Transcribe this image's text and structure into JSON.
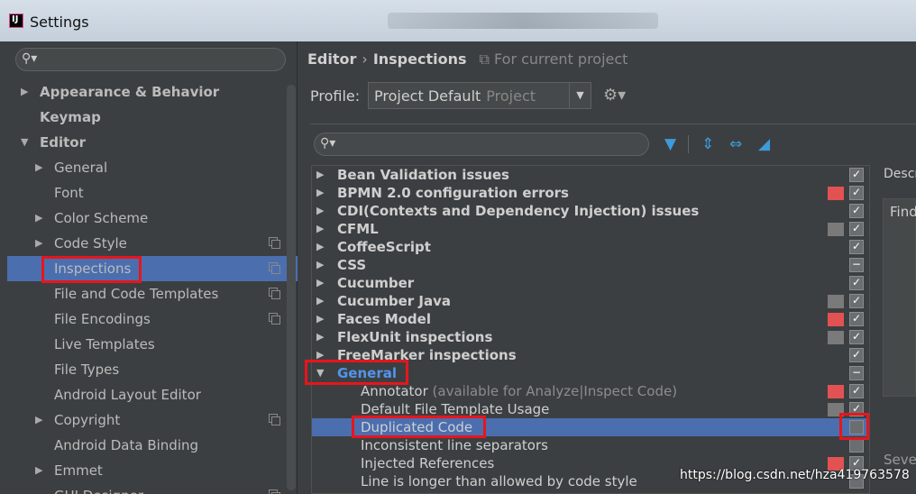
{
  "window": {
    "title": "Settings",
    "app_icon": "IJ"
  },
  "left": {
    "search_placeholder": "",
    "items": [
      {
        "label": "Appearance & Behavior",
        "level": 0,
        "arrow": "▶",
        "bold": true
      },
      {
        "label": "Keymap",
        "level": 0,
        "arrow": "",
        "bold": true
      },
      {
        "label": "Editor",
        "level": 0,
        "arrow": "▼",
        "bold": true
      },
      {
        "label": "General",
        "level": 1,
        "arrow": "▶"
      },
      {
        "label": "Font",
        "level": 1,
        "arrow": ""
      },
      {
        "label": "Color Scheme",
        "level": 1,
        "arrow": "▶"
      },
      {
        "label": "Code Style",
        "level": 1,
        "arrow": "▶",
        "proj": true
      },
      {
        "label": "Inspections",
        "level": 1,
        "arrow": "",
        "proj": true,
        "selected": true
      },
      {
        "label": "File and Code Templates",
        "level": 1,
        "arrow": "",
        "proj": true
      },
      {
        "label": "File Encodings",
        "level": 1,
        "arrow": "",
        "proj": true
      },
      {
        "label": "Live Templates",
        "level": 1,
        "arrow": ""
      },
      {
        "label": "File Types",
        "level": 1,
        "arrow": ""
      },
      {
        "label": "Android Layout Editor",
        "level": 1,
        "arrow": ""
      },
      {
        "label": "Copyright",
        "level": 1,
        "arrow": "▶",
        "proj": true
      },
      {
        "label": "Android Data Binding",
        "level": 1,
        "arrow": ""
      },
      {
        "label": "Emmet",
        "level": 1,
        "arrow": "▶"
      },
      {
        "label": "GUI Designer",
        "level": 1,
        "arrow": "",
        "proj": true
      }
    ]
  },
  "right": {
    "breadcrumb": {
      "parent": "Editor",
      "current": "Inspections",
      "scope": "For current project"
    },
    "profile": {
      "label": "Profile:",
      "value": "Project Default",
      "scope": "Project"
    },
    "search_placeholder": "",
    "description_label": "Descr",
    "description_text": "Find",
    "severity_label": "Seve",
    "inspections": [
      {
        "label": "Bean Validation issues",
        "type": "group",
        "severity": "",
        "check": "✓"
      },
      {
        "label": "BPMN 2.0 configuration errors",
        "type": "group",
        "severity": "#e35252",
        "check": "✓"
      },
      {
        "label": "CDI(Contexts and Dependency Injection) issues",
        "type": "group",
        "severity": "",
        "check": "✓"
      },
      {
        "label": "CFML",
        "type": "group",
        "severity": "#7a7a7a",
        "check": "✓"
      },
      {
        "label": "CoffeeScript",
        "type": "group",
        "severity": "",
        "check": "✓"
      },
      {
        "label": "CSS",
        "type": "group",
        "severity": "",
        "check": "−"
      },
      {
        "label": "Cucumber",
        "type": "group",
        "severity": "",
        "check": "✓"
      },
      {
        "label": "Cucumber Java",
        "type": "group",
        "severity": "#7a7a7a",
        "check": "✓"
      },
      {
        "label": "Faces Model",
        "type": "group",
        "severity": "#e35252",
        "check": "✓"
      },
      {
        "label": "FlexUnit inspections",
        "type": "group",
        "severity": "#7a7a7a",
        "check": "✓"
      },
      {
        "label": "FreeMarker inspections",
        "type": "group",
        "severity": "",
        "check": "✓"
      },
      {
        "label": "General",
        "type": "group-open",
        "severity": "",
        "check": "−"
      },
      {
        "label": "Annotator",
        "suffix": "(available for Analyze|Inspect Code)",
        "type": "child",
        "severity": "#e35252",
        "check": "✓"
      },
      {
        "label": "Default File Template Usage",
        "type": "child",
        "severity": "#7a7a7a",
        "check": "✓"
      },
      {
        "label": "Duplicated Code",
        "type": "child",
        "severity": "",
        "check": "",
        "selected": true
      },
      {
        "label": "Inconsistent line separators",
        "type": "child",
        "severity": "",
        "check": ""
      },
      {
        "label": "Injected References",
        "type": "child",
        "severity": "#e35252",
        "check": "✓"
      },
      {
        "label": "Line is longer than allowed by code style",
        "type": "child",
        "severity": "",
        "check": ""
      }
    ]
  },
  "watermark": "https://blog.csdn.net/hza419763578"
}
